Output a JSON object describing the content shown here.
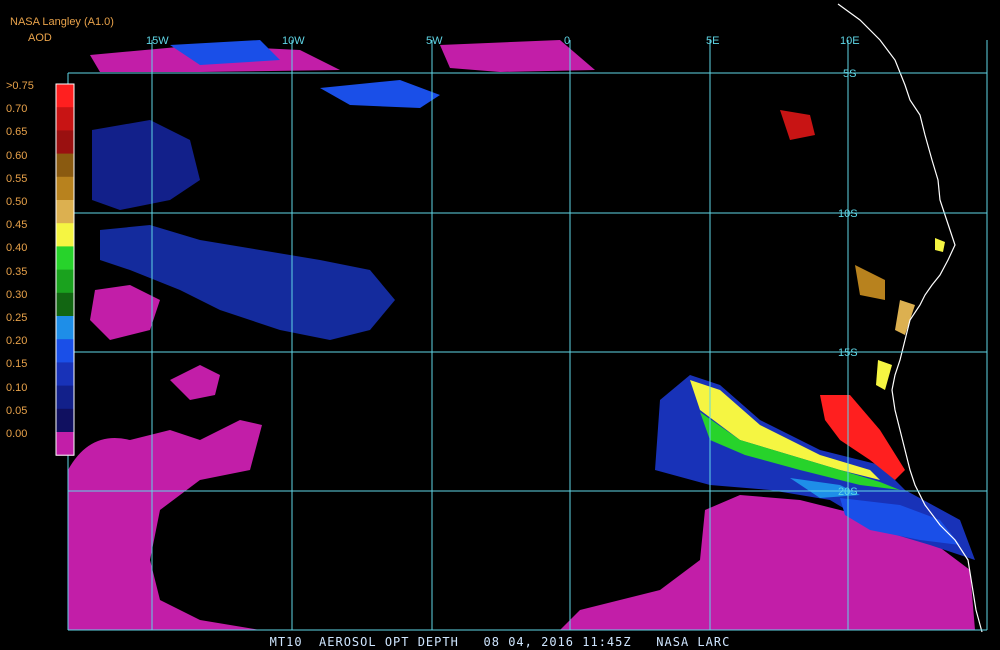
{
  "header": {
    "product": "NASA Langley (A1.0)",
    "variable": "AOD"
  },
  "colors": {
    "grid": "#5fd6e6",
    "coast": "#ffffff",
    "label": "#e8a24a",
    "footer": "#cfe6ff"
  },
  "legend": {
    "labels": [
      ">0.75",
      "0.70",
      "0.65",
      "0.60",
      "0.55",
      "0.50",
      "0.45",
      "0.40",
      "0.35",
      "0.30",
      "0.25",
      "0.20",
      "0.15",
      "0.10",
      "0.05",
      "0.00"
    ],
    "colors": [
      "#ff1f1f",
      "#c81414",
      "#9a1010",
      "#8a5a10",
      "#b8821e",
      "#dcb050",
      "#f5f542",
      "#27d32b",
      "#1aa21e",
      "#126612",
      "#1e8ee8",
      "#1a4fe8",
      "#1832b8",
      "#12208a",
      "#101060",
      "#c21ea8"
    ]
  },
  "grid": {
    "lon_labels": [
      "15W",
      "10W",
      "5W",
      "0",
      "5E",
      "10E"
    ],
    "lat_labels": [
      "5S",
      "10S",
      "15S",
      "20S"
    ]
  },
  "footer": {
    "sat": "MT10",
    "title": "AEROSOL OPT DEPTH",
    "date": "08 04, 2016",
    "time": "11:45Z",
    "org": "NASA LARC"
  }
}
